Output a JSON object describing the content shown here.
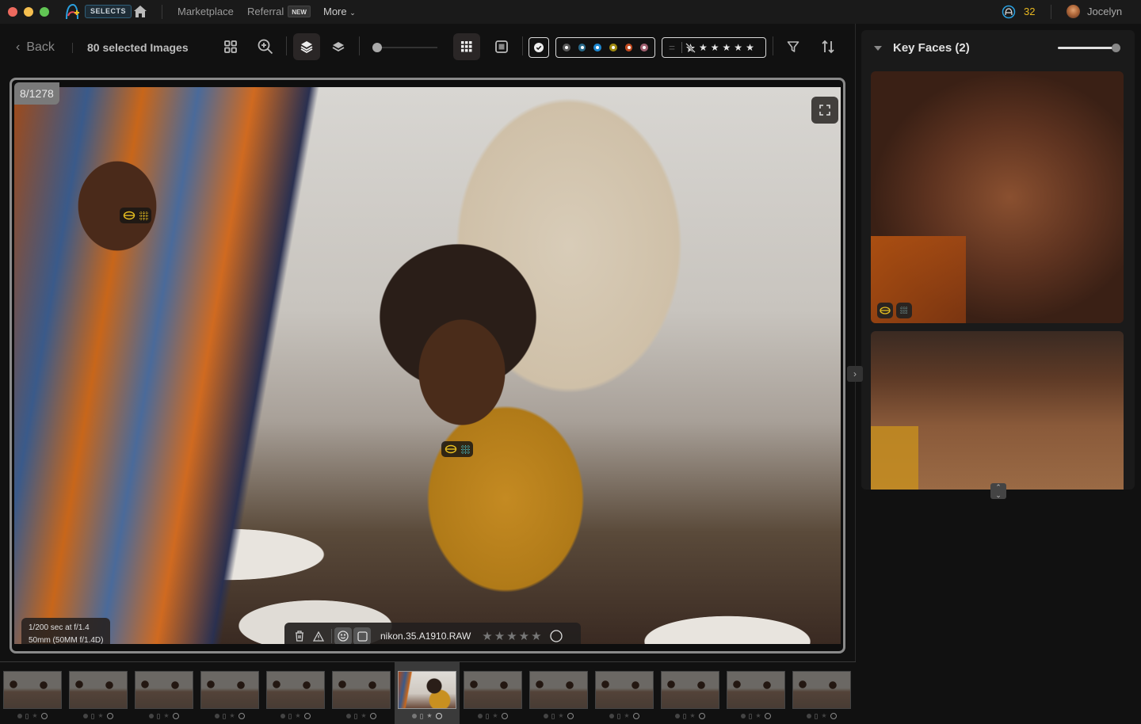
{
  "titlebar": {
    "app_badge": "SELECTS",
    "nav": [
      {
        "label": "Marketplace"
      },
      {
        "label": "Referral",
        "badge": "NEW"
      },
      {
        "label": "More"
      }
    ],
    "credits": "32",
    "user_name": "Jocelyn"
  },
  "toolbar": {
    "back_label": "Back",
    "selected_count": "80 selected Images",
    "zoom_slider_value": 0,
    "color_labels": [
      "#5a5a5a",
      "#2a6a8a",
      "#1e88d0",
      "#a08a10",
      "#c04a20",
      "#a06070"
    ],
    "rating_filter": {
      "equals_symbol": "=",
      "stars": 5
    }
  },
  "viewer": {
    "counter": "8/1278",
    "exif_line1": "1/200 sec at f/1.4",
    "exif_line2": "50mm (50MM f/1.4D)",
    "filename": "nikon.35.A1910.RAW",
    "rating": 0,
    "face_color": "#e8c020"
  },
  "key_faces": {
    "title": "Key Faces (2)",
    "slider_value": 100
  },
  "filmstrip": {
    "count": 13,
    "selected_index": 6
  }
}
